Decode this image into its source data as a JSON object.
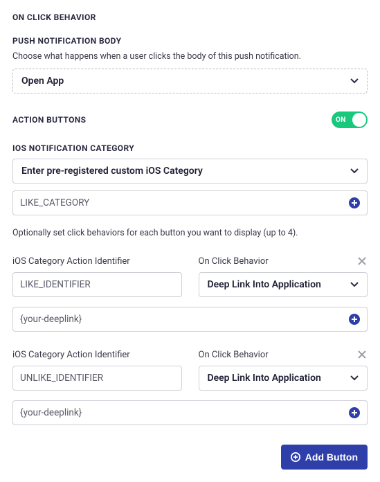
{
  "header": {
    "title": "ON CLICK BEHAVIOR"
  },
  "pushBody": {
    "title": "PUSH NOTIFICATION BODY",
    "hint": "Choose what happens when a user clicks the body of this push notification.",
    "select": "Open App"
  },
  "actionButtons": {
    "title": "ACTION BUTTONS",
    "toggle": "ON"
  },
  "iosCategory": {
    "title": "IOS NOTIFICATION CATEGORY",
    "select": "Enter pre-registered custom iOS Category",
    "input": "LIKE_CATEGORY",
    "hint": "Optionally set click behaviors for each button you want to display (up to 4)."
  },
  "labels": {
    "identifier": "iOS Category Action Identifier",
    "onClick": "On Click Behavior"
  },
  "buttons": [
    {
      "identifier": "LIKE_IDENTIFIER",
      "onClick": "Deep Link Into Application",
      "deeplink": "{your-deeplink}"
    },
    {
      "identifier": "UNLIKE_IDENTIFIER",
      "onClick": "Deep Link Into Application",
      "deeplink": "{your-deeplink}"
    }
  ],
  "footer": {
    "addButton": "Add Button"
  }
}
